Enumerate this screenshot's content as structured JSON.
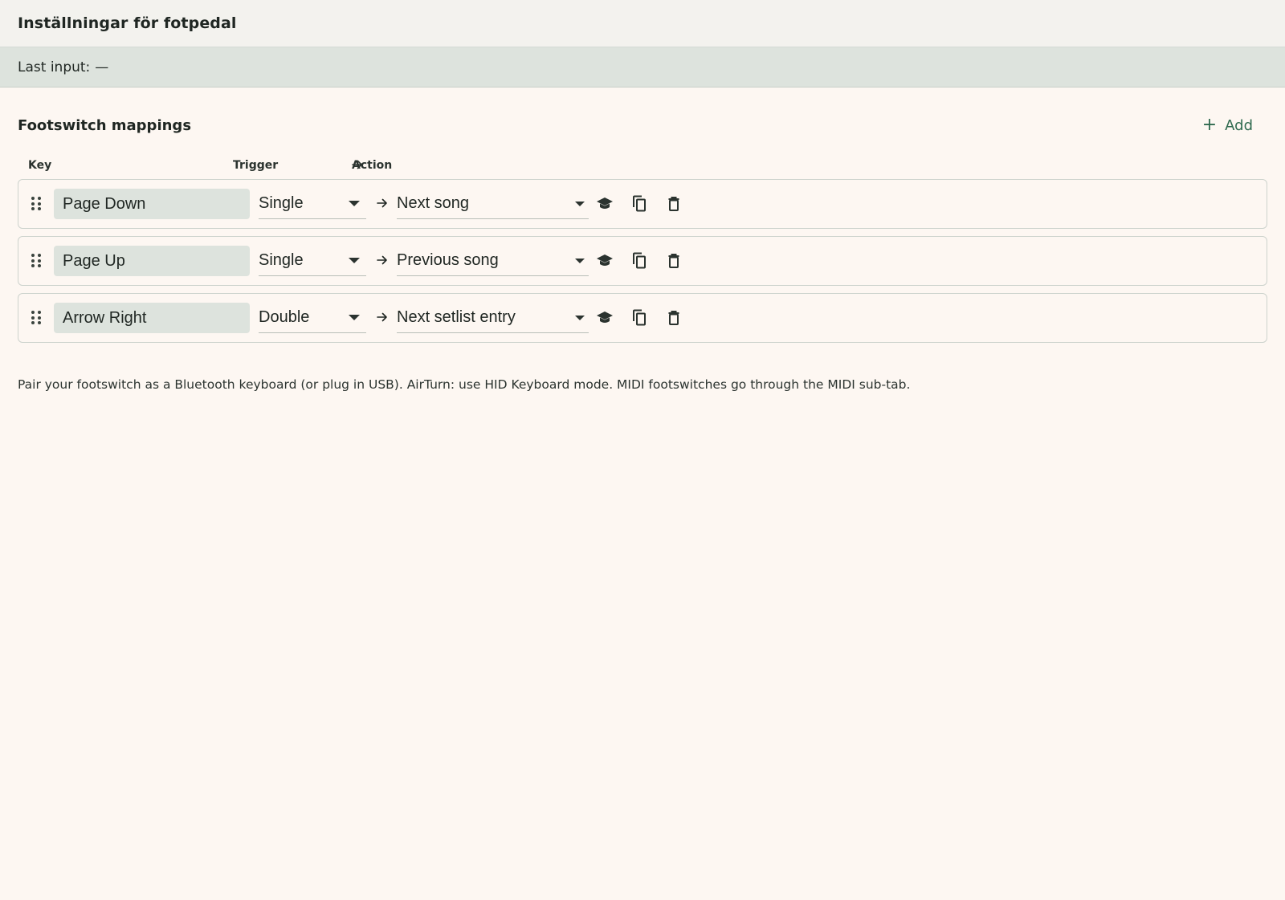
{
  "window": {
    "title": "Inställningar för fotpedal"
  },
  "status": {
    "label": "Last input:",
    "value": "—"
  },
  "section": {
    "title": "Footswitch mappings",
    "add_label": "Add"
  },
  "columns": {
    "key": "Key",
    "trigger": "Trigger",
    "action": "Action"
  },
  "mappings": [
    {
      "key": "Page Down",
      "trigger": "Single",
      "action": "Next song"
    },
    {
      "key": "Page Up",
      "trigger": "Single",
      "action": "Previous song"
    },
    {
      "key": "Arrow Right",
      "trigger": "Double",
      "action": "Next setlist entry"
    }
  ],
  "hint": "Pair your footswitch as a Bluetooth keyboard (or plug in USB). AirTurn: use HID Keyboard mode. MIDI footswitches go through the MIDI sub-tab.",
  "icons": {
    "drag": "drag-handle-icon",
    "arrow": "arrow-right-icon",
    "learn": "graduation-cap-icon",
    "copy": "copy-icon",
    "delete": "trash-icon",
    "add": "plus-icon"
  },
  "colors": {
    "accent": "#2f6a4f",
    "background": "#fdf7f2",
    "status_bg": "#dde3dd"
  }
}
